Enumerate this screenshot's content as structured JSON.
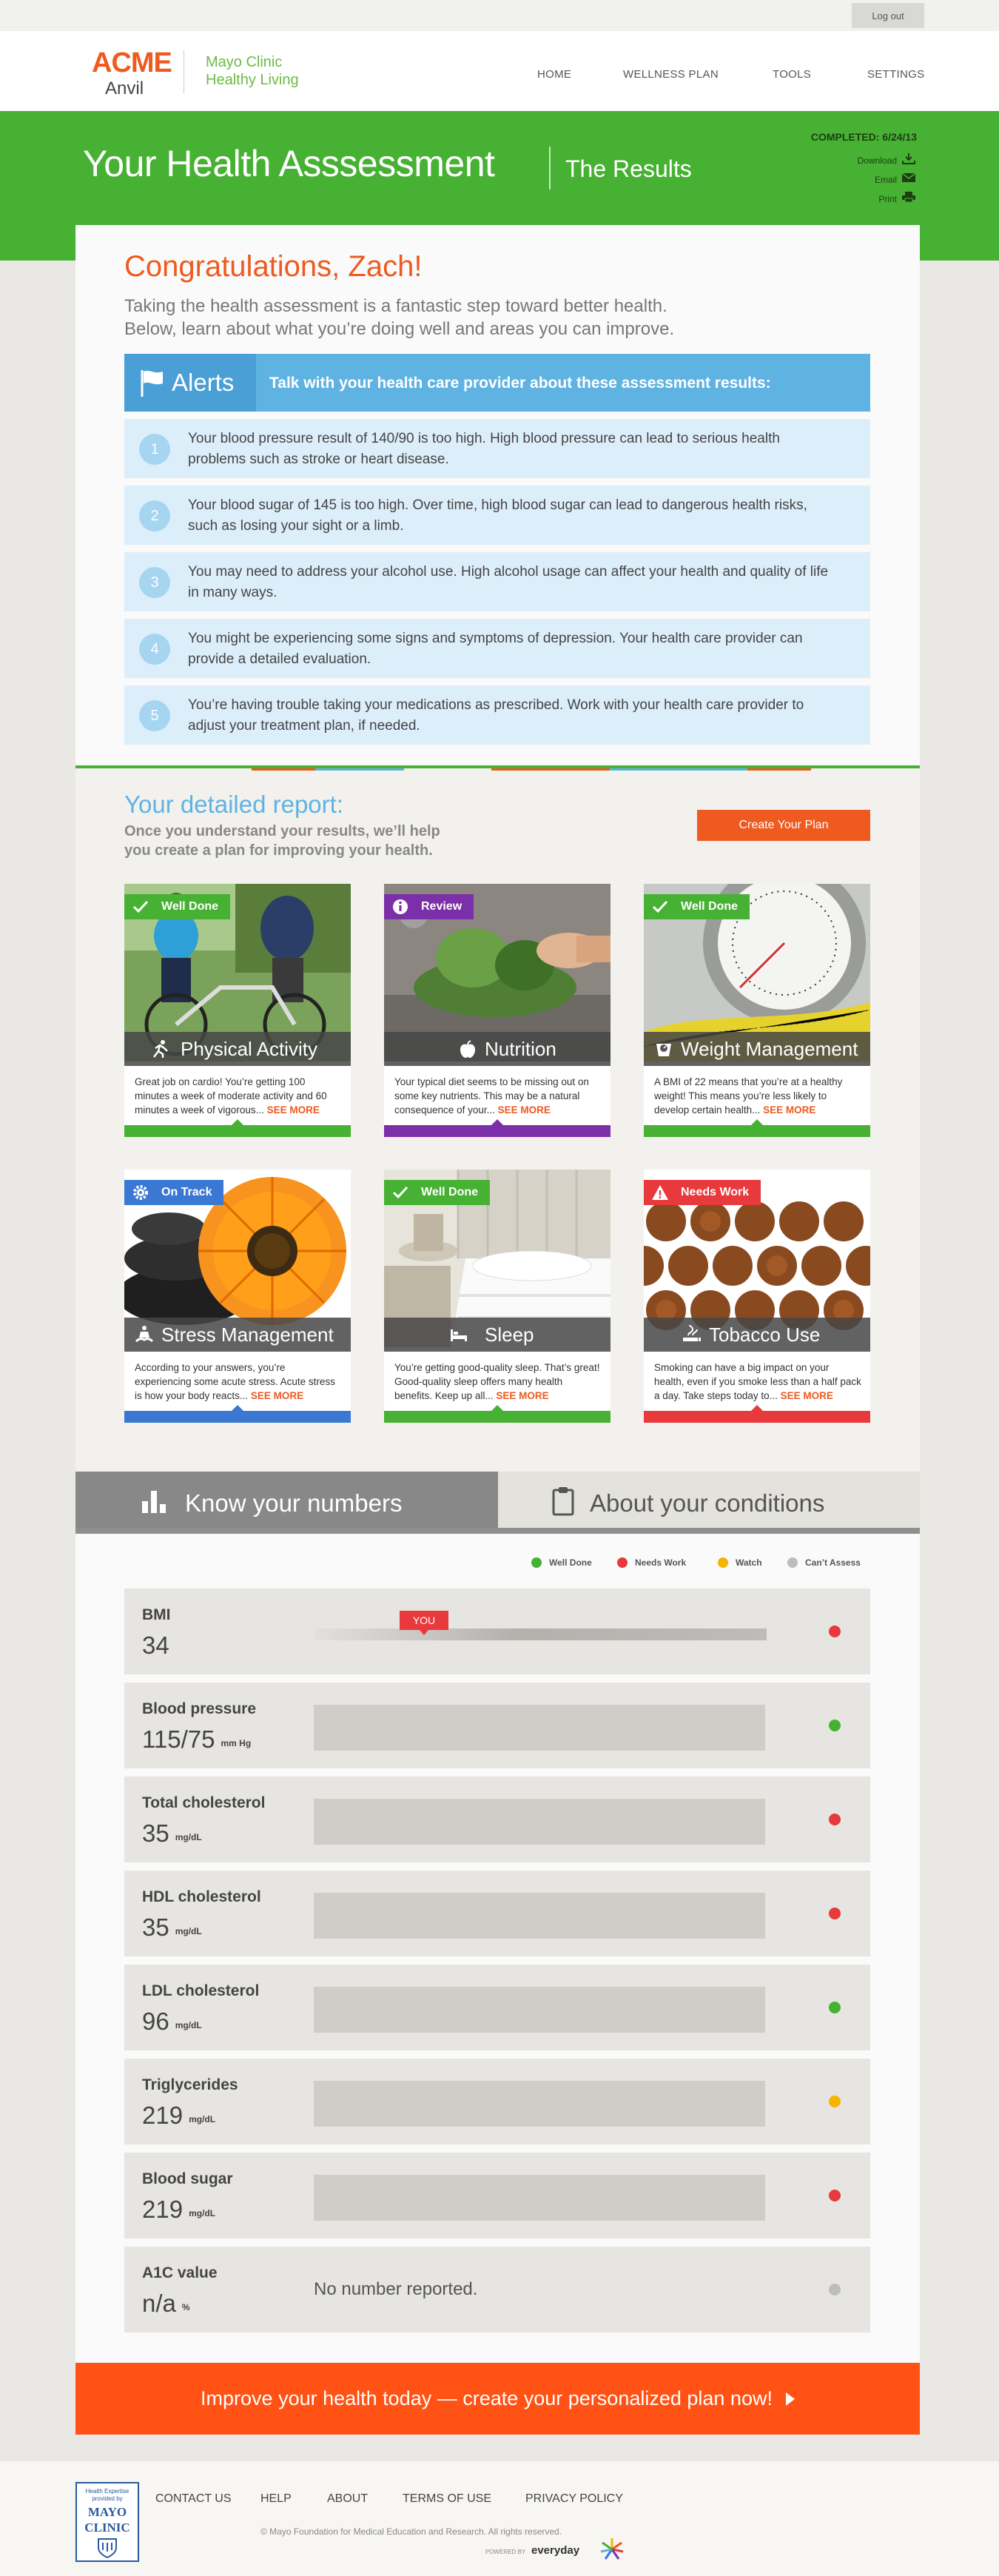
{
  "topbar": {
    "logout": "Log out"
  },
  "brand": {
    "acme": "ACME",
    "anvil": "Anvil",
    "partner_line1": "Mayo Clinic",
    "partner_line2": "Healthy Living"
  },
  "nav": {
    "items": [
      "HOME",
      "WELLNESS PLAN",
      "TOOLS",
      "SETTINGS"
    ]
  },
  "banner": {
    "title": "Your Health Asssessment",
    "subtitle": "The Results",
    "completed": "COMPLETED: 6/24/13",
    "links": [
      "Download",
      "Email",
      "Print"
    ]
  },
  "intro": {
    "greeting": "Congratulations, Zach!",
    "line1": "Taking the health assessment is a fantastic step toward better health.",
    "line2": "Below, learn about what you’re doing well and areas you can improve."
  },
  "alerts": {
    "title": "Alerts",
    "message": "Talk with your health care provider about these assessment results:",
    "items": [
      {
        "n": "1",
        "text": "Your blood pressure result of 140/90 is too high. High blood pressure can lead to serious health problems such as stroke or heart disease."
      },
      {
        "n": "2",
        "text": "Your blood sugar of 145 is too high. Over time, high blood sugar can lead to dangerous health risks, such as losing your sight or a limb."
      },
      {
        "n": "3",
        "text": "You may need to address your alcohol use. High alcohol usage can affect your health and quality of life in many ways."
      },
      {
        "n": "4",
        "text": "You might be experiencing some signs and symptoms of depression. Your health care provider can provide a detailed evaluation."
      },
      {
        "n": "5",
        "text": "You’re having trouble taking your medications as prescribed. Work with your health care provider to adjust your treatment plan, if needed."
      }
    ]
  },
  "report": {
    "heading": "Your detailed report:",
    "sub1": "Once you understand your results, we’ll help",
    "sub2": "you create a plan for improving your health.",
    "button": "Create Your Plan",
    "see_more": "SEE MORE",
    "tiles": [
      {
        "name": "Physical Activity",
        "badge": "Well Done",
        "color": "#46b133",
        "icon": "running-icon",
        "desc": "Great job on cardio! You’re getting 100 minutes a week of moderate activity and 60 minutes a week of vigorous..."
      },
      {
        "name": "Nutrition",
        "badge": "Review",
        "color": "#7b2fa8",
        "icon": "apple-icon",
        "desc": "Your typical diet seems to be missing out on some key nutrients. This may be a natural consequence of your..."
      },
      {
        "name": "Weight Management",
        "badge": "Well Done",
        "color": "#46b133",
        "icon": "scale-icon",
        "desc": "A BMI of 22 means that you’re at a healthy weight! This means you’re less likely to develop certain health..."
      },
      {
        "name": "Stress Management",
        "badge": "On Track",
        "color": "#3a78d4",
        "icon": "meditation-icon",
        "desc": "According to your answers, you’re experiencing some acute stress. Acute stress is how your body reacts..."
      },
      {
        "name": "Sleep",
        "badge": "Well Done",
        "color": "#46b133",
        "icon": "bed-icon",
        "desc": "You’re getting good-quality sleep. That’s great! Good-quality sleep offers many health benefits. Keep up all..."
      },
      {
        "name": "Tobacco Use",
        "badge": "Needs Work",
        "color": "#e8393c",
        "icon": "smoking-icon",
        "desc": "Smoking can have a big impact on your health, even if you smoke less than a half pack a day. Take steps today to..."
      }
    ]
  },
  "tabs": {
    "numbers": "Know your numbers",
    "conditions": "About your conditions"
  },
  "legend": [
    {
      "label": "Well Done",
      "color": "#46b133"
    },
    {
      "label": "Needs Work",
      "color": "#e8393c"
    },
    {
      "label": "Watch",
      "color": "#f5b400"
    },
    {
      "label": "Can’t Assess",
      "color": "#bdbdbd"
    }
  ],
  "metrics": [
    {
      "name": "BMI",
      "value": "34",
      "unit": "",
      "status_color": "#e8393c",
      "marker": "YOU"
    },
    {
      "name": "Blood pressure",
      "value": "115/75",
      "unit": "mm Hg",
      "status_color": "#46b133"
    },
    {
      "name": "Total cholesterol",
      "value": "35",
      "unit": "mg/dL",
      "status_color": "#e8393c"
    },
    {
      "name": "HDL cholesterol",
      "value": "35",
      "unit": "mg/dL",
      "status_color": "#e8393c"
    },
    {
      "name": "LDL cholesterol",
      "value": "96",
      "unit": "mg/dL",
      "status_color": "#46b133"
    },
    {
      "name": "Triglycerides",
      "value": "219",
      "unit": "mg/dL",
      "status_color": "#f5b400"
    },
    {
      "name": "Blood sugar",
      "value": "219",
      "unit": "mg/dL",
      "status_color": "#e8393c"
    },
    {
      "name": "A1C value",
      "value": "n/a",
      "unit": "%",
      "status_color": "#bdbdbd",
      "note": "No number reported."
    }
  ],
  "cta": "Improve your health today — create your personalized plan now!",
  "footer": {
    "mayo_small": "Health Expertise provided by",
    "mayo_name1": "MAYO",
    "mayo_name2": "CLINIC",
    "links": [
      "CONTACT US",
      "HELP",
      "ABOUT",
      "TERMS OF USE",
      "PRIVACY POLICY"
    ],
    "copyright": "©          Mayo Foundation for Medical Education and Research. All rights reserved.",
    "powered": "POWERED BY",
    "everyday": "everyday"
  },
  "colors": {
    "green": "#46b133",
    "orange": "#ee5a1f",
    "blue": "#5fb3e2",
    "cta": "#ff5214"
  }
}
